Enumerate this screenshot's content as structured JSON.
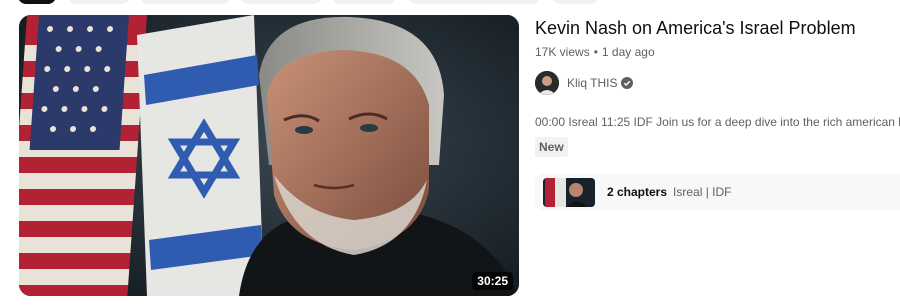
{
  "video": {
    "title": "Kevin Nash on America's Israel Problem",
    "views": "17K views",
    "age": "1 day ago",
    "duration": "30:25",
    "channel": "Kliq THIS",
    "description": "00:00 Isreal 11:25 IDF Join us for a deep dive into the rich american h",
    "badge": "New",
    "chapters_count": "2 chapters",
    "chapters_list": "Isreal | IDF"
  },
  "icons": {
    "verified": "verified-check-icon"
  },
  "colors": {
    "text_primary": "#0f0f0f",
    "text_secondary": "#606060",
    "badge_bg": "#f2f2f2"
  }
}
